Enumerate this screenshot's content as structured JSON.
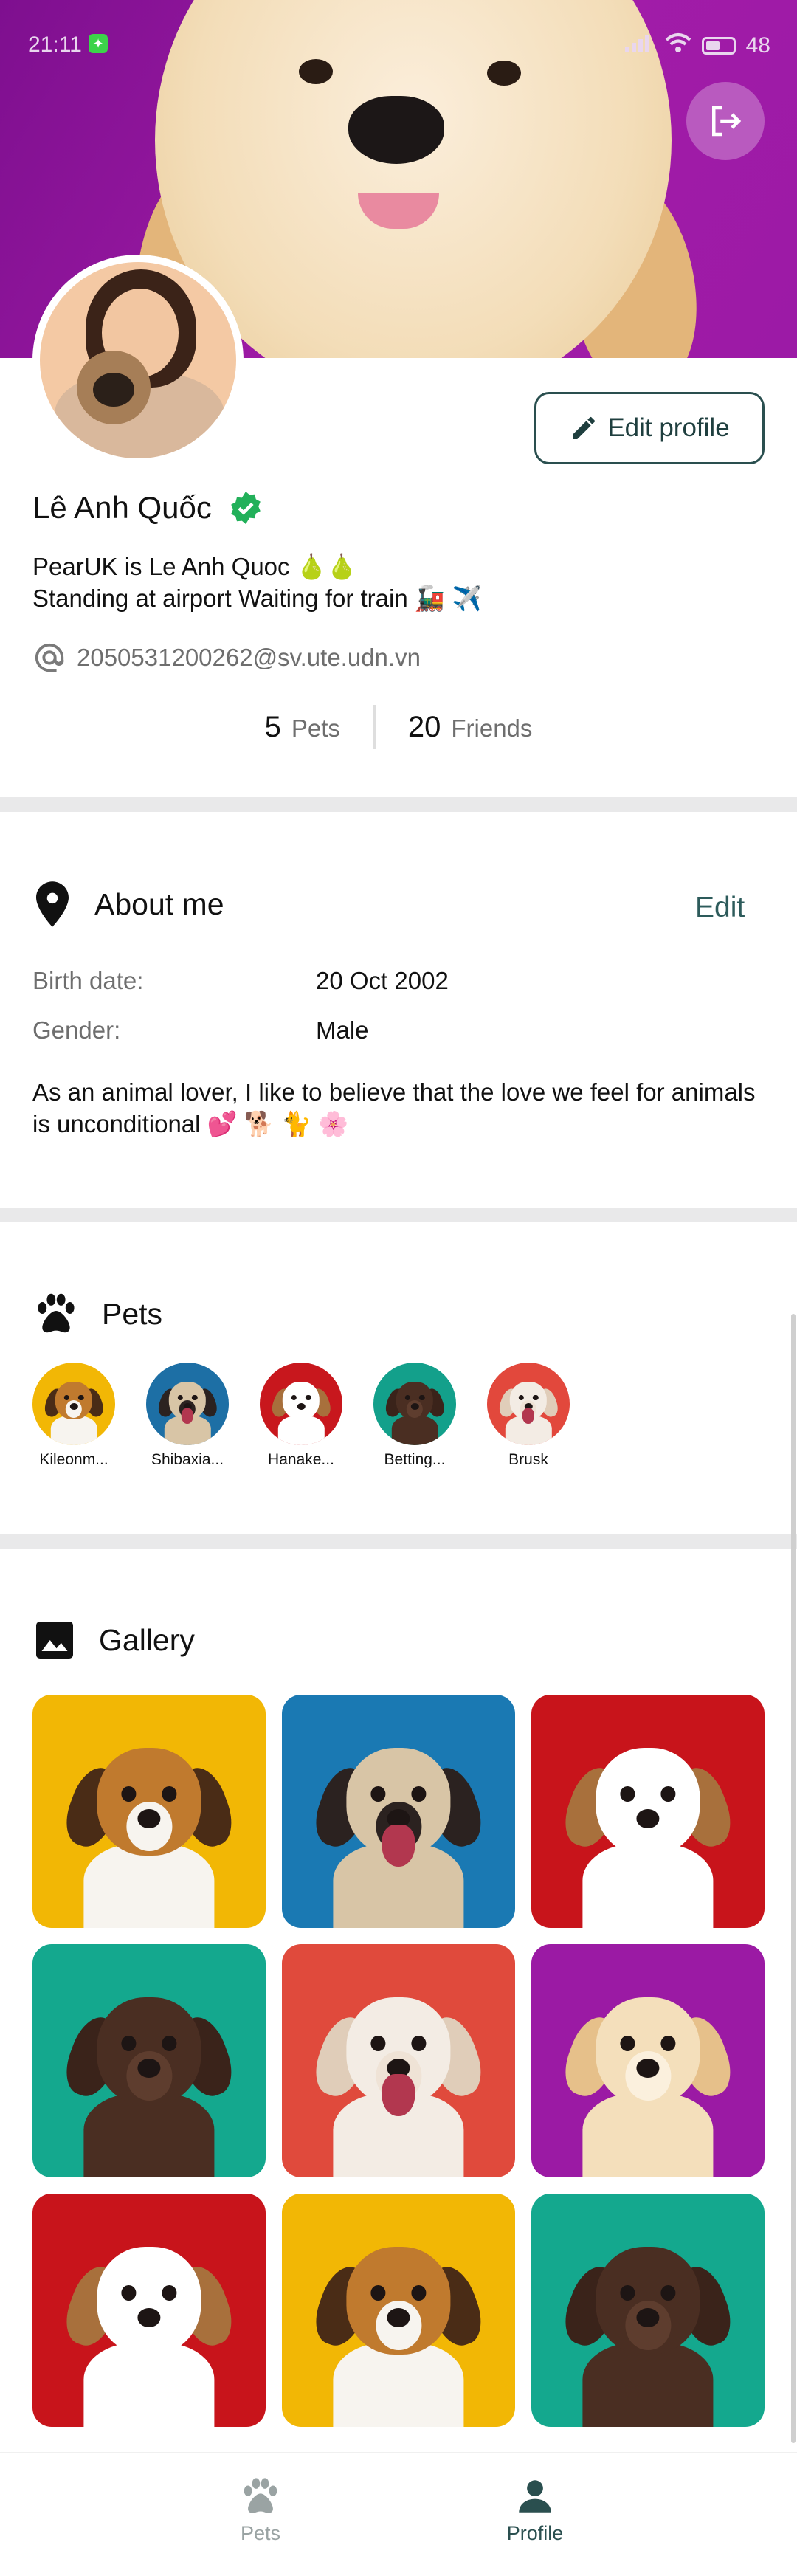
{
  "status_bar": {
    "time": "21:11",
    "battery": "48"
  },
  "profile": {
    "name": "Lê Anh Quốc",
    "bio_line1": "PearUK is Le Anh Quoc 🍐🍐",
    "bio_line2": "Standing at airport Waiting for train 🚂 ✈️",
    "email": "2050531200262@sv.ute.udn.vn",
    "edit_profile_label": "Edit profile",
    "pets_count": "5",
    "pets_label": "Pets",
    "friends_count": "20",
    "friends_label": "Friends"
  },
  "about": {
    "title": "About me",
    "edit_label": "Edit",
    "birth_label": "Birth date:",
    "birth_value": "20 Oct 2002",
    "gender_label": "Gender:",
    "gender_value": "Male",
    "description": "As an animal lover, I like to believe that the love we feel for animals is unconditional 💕 🐕 🐈 🌸"
  },
  "pets": {
    "title": "Pets",
    "items": [
      {
        "name": "Kileonm...",
        "bg": "#f2b705"
      },
      {
        "name": "Shibaxia...",
        "bg": "#1d6fa5"
      },
      {
        "name": "Hanake...",
        "bg": "#c8171d"
      },
      {
        "name": "Betting...",
        "bg": "#13a08b"
      },
      {
        "name": "Brusk",
        "bg": "#e2483c"
      }
    ]
  },
  "gallery": {
    "title": "Gallery",
    "items": [
      {
        "bg": "#f2b705",
        "breed": "beagle"
      },
      {
        "bg": "#1a79b3",
        "breed": "pug"
      },
      {
        "bg": "#c8141b",
        "breed": "terrier"
      },
      {
        "bg": "#14a88e",
        "breed": "labrador"
      },
      {
        "bg": "#e04a3c",
        "breed": "bulldog"
      },
      {
        "bg": "#9b1aa4",
        "breed": "retriever"
      },
      {
        "bg": "#c8141b",
        "breed": "terrier"
      },
      {
        "bg": "#f2b705",
        "breed": "beagle"
      },
      {
        "bg": "#14a88e",
        "breed": "labrador"
      }
    ]
  },
  "nav": {
    "pets_label": "Pets",
    "profile_label": "Profile",
    "active": "Profile",
    "active_color": "#2a4f4f",
    "inactive_color": "#9aa3a3"
  }
}
